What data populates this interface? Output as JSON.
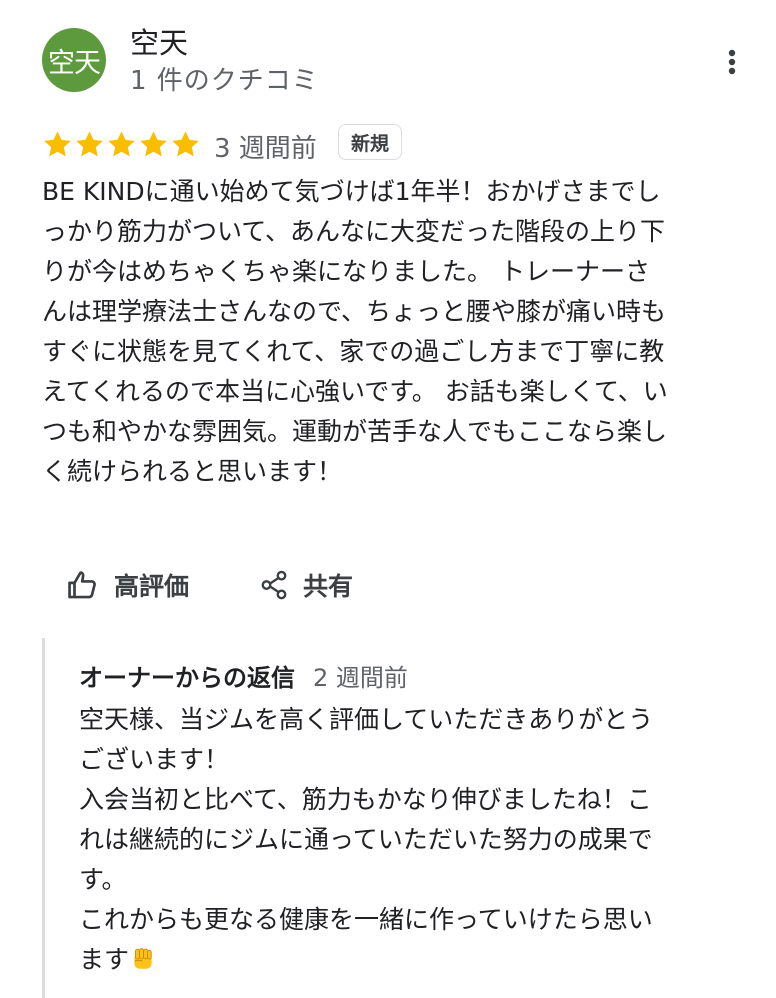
{
  "reviewer": {
    "avatar_text": "空天",
    "avatar_color": "#5d9a3e",
    "name": "空天",
    "meta": "1 件のクチコミ"
  },
  "menu": {
    "icon": "more-vert-icon"
  },
  "review": {
    "rating": 5,
    "max_rating": 5,
    "star_color": "#fbbc04",
    "date": "3 週間前",
    "badge": "新規",
    "lines": [
      "BE KINDに通い始めて気づけば1年半！おかげさまでし",
      "っかり筋力がついて、あんなに大変だった階段の上り下",
      "りが今はめちゃくちゃ楽になりました。 トレーナーさ",
      "んは理学療法士さんなので、ちょっと腰や膝が痛い時も",
      "すぐに状態を見てくれて、家での過ごし方まで丁寧に教",
      "えてくれるので本当に心強いです。 お話も楽しくて、い",
      "つも和やかな雰囲気。運動が苦手な人でもここなら楽し",
      "く続けられると思います！"
    ]
  },
  "actions": {
    "like_label": "高評価",
    "like_icon": "thumbs-up-icon",
    "share_label": "共有",
    "share_icon": "share-icon"
  },
  "owner_reply": {
    "title": "オーナーからの返信",
    "date": "2 週間前",
    "lines": [
      "空天様、当ジムを高く評価していただきありがとう",
      "ございます！",
      "入会当初と比べて、筋力もかなり伸びましたね！こ",
      "れは継続的にジムに通っていただいた努力の成果で",
      "す。",
      "これからも更なる健康を一緒に作っていけたら思い",
      "ます"
    ],
    "trailing_emoji_icon": "raised-fist-emoji-icon"
  }
}
